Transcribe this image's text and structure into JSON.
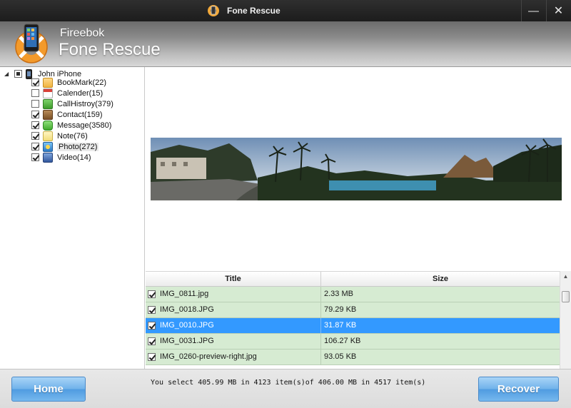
{
  "window": {
    "title": "Fone Rescue",
    "min_symbol": "—",
    "close_symbol": "✕"
  },
  "header": {
    "brand": "Fireebok",
    "product": "Fone Rescue"
  },
  "tree": {
    "root": {
      "label": "John iPhone",
      "icon": "phone-icon",
      "state": "partial"
    },
    "items": [
      {
        "label": "BookMark(22)",
        "icon": "folder-icon",
        "checked": true
      },
      {
        "label": "Calender(15)",
        "icon": "calendar-icon",
        "checked": false
      },
      {
        "label": "CallHistroy(379)",
        "icon": "phone-call-icon",
        "checked": false
      },
      {
        "label": "Contact(159)",
        "icon": "contacts-icon",
        "checked": true
      },
      {
        "label": "Message(3580)",
        "icon": "message-icon",
        "checked": true
      },
      {
        "label": "Note(76)",
        "icon": "note-icon",
        "checked": true
      },
      {
        "label": "Photo(272)",
        "icon": "photo-icon",
        "checked": true,
        "selected": true
      },
      {
        "label": "Video(14)",
        "icon": "video-icon",
        "checked": true
      }
    ]
  },
  "table": {
    "columns": {
      "title": "Title",
      "size": "Size"
    },
    "rows": [
      {
        "title": "IMG_0811.jpg",
        "size": "2.33 MB",
        "checked": true
      },
      {
        "title": "IMG_0018.JPG",
        "size": "79.29 KB",
        "checked": true
      },
      {
        "title": "IMG_0010.JPG",
        "size": "31.87 KB",
        "checked": true,
        "selected": true
      },
      {
        "title": "IMG_0031.JPG",
        "size": "106.27 KB",
        "checked": true
      },
      {
        "title": "IMG_0260-preview-right.jpg",
        "size": "93.05 KB",
        "checked": true
      }
    ],
    "selected_row_color": "#3399ff",
    "row_color": "#d6ebd2"
  },
  "footer": {
    "home_label": "Home",
    "recover_label": "Recover",
    "status": "You select 405.99 MB in 4123 item(s)of 406.00 MB in 4517 item(s)"
  },
  "colors": {
    "accent": "#4f9be0",
    "titlebar": "#262626"
  }
}
